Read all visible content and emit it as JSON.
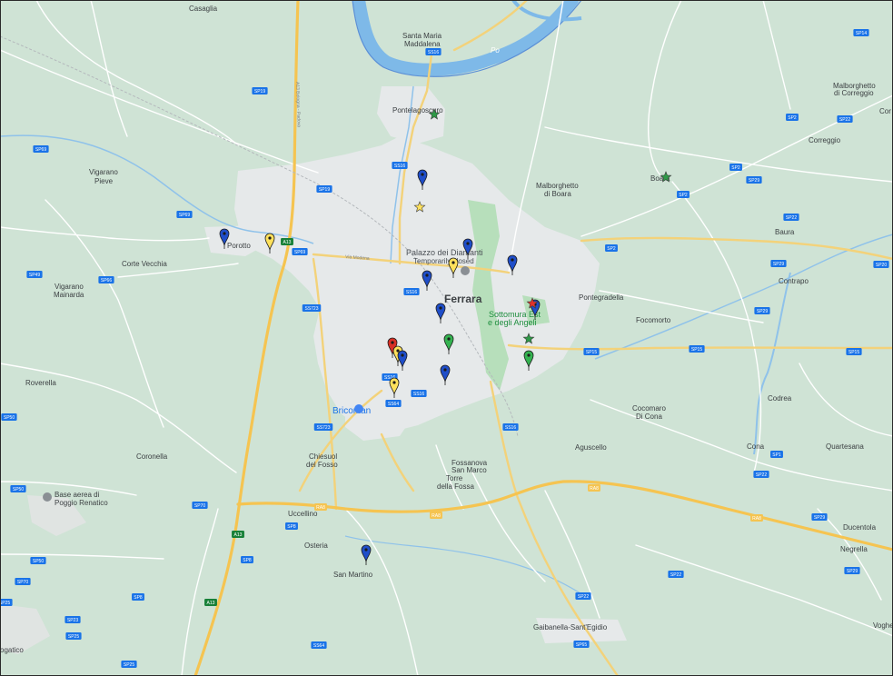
{
  "colors": {
    "land": "#cfe3d5",
    "urban": "#e6e9ea",
    "water": "#7eb9e8",
    "water_edge": "#5b8fd6",
    "motorway": "#f5c451",
    "major_road": "#f3d27a",
    "minor_road": "#ffffff",
    "park": "#b7dfbb",
    "shield": "#1a73e8",
    "pin_blue": "#1f4ec9",
    "pin_yellow": "#ffe15c",
    "pin_red": "#d93025",
    "pin_green": "#34b350",
    "star_green": "#2e9a47",
    "star_yellow": "#ffe15c",
    "star_red": "#e0322b"
  },
  "places": [
    {
      "id": "casaglia",
      "text": "Casaglia",
      "cls": "lbl-town"
    },
    {
      "id": "santa-maria-1",
      "text": "Santa Maria",
      "cls": "lbl-town"
    },
    {
      "id": "santa-maria-2",
      "text": "Maddalena",
      "cls": "lbl-town"
    },
    {
      "id": "pontelagoscuro",
      "text": "Pontelagoscuro",
      "cls": "lbl-town"
    },
    {
      "id": "vigarano-pieve-1",
      "text": "Vigarano",
      "cls": "lbl-town"
    },
    {
      "id": "vigarano-pieve-2",
      "text": "Pieve",
      "cls": "lbl-town"
    },
    {
      "id": "porotto",
      "text": "Porotto",
      "cls": "lbl-town"
    },
    {
      "id": "corte-vecchia",
      "text": "Corte Vecchia",
      "cls": "lbl-town"
    },
    {
      "id": "vigarano-mainarda-1",
      "text": "Vigarano",
      "cls": "lbl-town"
    },
    {
      "id": "vigarano-mainarda-2",
      "text": "Mainarda",
      "cls": "lbl-town"
    },
    {
      "id": "malborghetto-boara-1",
      "text": "Malborghetto",
      "cls": "lbl-town"
    },
    {
      "id": "malborghetto-boara-2",
      "text": "di Boara",
      "cls": "lbl-town"
    },
    {
      "id": "boara",
      "text": "Boara",
      "cls": "lbl-town"
    },
    {
      "id": "malborghetto-correggio-1",
      "text": "Malborghetto",
      "cls": "lbl-town"
    },
    {
      "id": "malborghetto-correggio-2",
      "text": "di Correggio",
      "cls": "lbl-town"
    },
    {
      "id": "correggio",
      "text": "Correggio",
      "cls": "lbl-town"
    },
    {
      "id": "baura",
      "text": "Baura",
      "cls": "lbl-town"
    },
    {
      "id": "contrapo",
      "text": "Contrapo",
      "cls": "lbl-town"
    },
    {
      "id": "pontegradella",
      "text": "Pontegradella",
      "cls": "lbl-town"
    },
    {
      "id": "focomorto",
      "text": "Focomorto",
      "cls": "lbl-town"
    },
    {
      "id": "ferrara",
      "text": "Ferrara",
      "cls": "lbl-city"
    },
    {
      "id": "palazzo-1",
      "text": "Palazzo dei Diamanti",
      "cls": "lbl-poi"
    },
    {
      "id": "palazzo-2",
      "text": "Temporarily closed",
      "cls": "lbl"
    },
    {
      "id": "sottomura-1",
      "text": "Sottomura Est",
      "cls": "lbl-green"
    },
    {
      "id": "sottomura-2",
      "text": "e degli Angeli",
      "cls": "lbl-green"
    },
    {
      "id": "roverella",
      "text": "Roverella",
      "cls": "lbl-town"
    },
    {
      "id": "bricoman",
      "text": "Bricoman",
      "cls": "lbl-blue"
    },
    {
      "id": "chiesuol-1",
      "text": "Chiesuol",
      "cls": "lbl-town"
    },
    {
      "id": "chiesuol-2",
      "text": "del Fosso",
      "cls": "lbl-town"
    },
    {
      "id": "coronella",
      "text": "Coronella",
      "cls": "lbl-town"
    },
    {
      "id": "base-aerea-1",
      "text": "Base aerea di",
      "cls": "lbl-town"
    },
    {
      "id": "base-aerea-2",
      "text": "Poggio Renatico",
      "cls": "lbl-town"
    },
    {
      "id": "fossanova-1",
      "text": "Fossanova",
      "cls": "lbl-town"
    },
    {
      "id": "fossanova-2",
      "text": "San Marco",
      "cls": "lbl-town"
    },
    {
      "id": "torre-1",
      "text": "Torre",
      "cls": "lbl-town"
    },
    {
      "id": "torre-2",
      "text": "della Fossa",
      "cls": "lbl-town"
    },
    {
      "id": "aguscello",
      "text": "Aguscello",
      "cls": "lbl-town"
    },
    {
      "id": "cocomaro-1",
      "text": "Cocomaro",
      "cls": "lbl-town"
    },
    {
      "id": "cocomaro-2",
      "text": "Di Cona",
      "cls": "lbl-town"
    },
    {
      "id": "codrea",
      "text": "Codrea",
      "cls": "lbl-town"
    },
    {
      "id": "cona",
      "text": "Cona",
      "cls": "lbl-town"
    },
    {
      "id": "quartesana",
      "text": "Quartesana",
      "cls": "lbl-town"
    },
    {
      "id": "uccellino",
      "text": "Uccellino",
      "cls": "lbl-town"
    },
    {
      "id": "osteria",
      "text": "Osteria",
      "cls": "lbl-town"
    },
    {
      "id": "san-martino",
      "text": "San Martino",
      "cls": "lbl-town"
    },
    {
      "id": "ducentola",
      "text": "Ducentola",
      "cls": "lbl-town"
    },
    {
      "id": "negrella",
      "text": "Negrella",
      "cls": "lbl-town"
    },
    {
      "id": "gaibanella",
      "text": "Gaibanella-Sant'Egidio",
      "cls": "lbl-town"
    },
    {
      "id": "voghe",
      "text": "Voghe",
      "cls": "lbl-town"
    },
    {
      "id": "cor",
      "text": "Cor",
      "cls": "lbl-town"
    },
    {
      "id": "ogatico",
      "text": "ogatico",
      "cls": "lbl-town"
    },
    {
      "id": "po-river",
      "text": "Po",
      "cls": "lbl-river"
    },
    {
      "id": "a13-name",
      "text": "A13 Bologna - Padova",
      "cls": "lbl-roadname"
    },
    {
      "id": "via-modena",
      "text": "Via Modena",
      "cls": "lbl-roadname"
    },
    {
      "id": "temp-closed",
      "text": "",
      "cls": "lbl"
    }
  ],
  "shields": [
    {
      "id": "ss16-top",
      "text": "SS16"
    },
    {
      "id": "ss16-a",
      "text": "SS16"
    },
    {
      "id": "ss16-b",
      "text": "SS16"
    },
    {
      "id": "ss16-c",
      "text": "SS16"
    },
    {
      "id": "ss16-d",
      "text": "SS16"
    },
    {
      "id": "ss16-e",
      "text": "SS16"
    },
    {
      "id": "sp19-a",
      "text": "SP19"
    },
    {
      "id": "sp19-b",
      "text": "SP19"
    },
    {
      "id": "sp69-a",
      "text": "SP69"
    },
    {
      "id": "sp69-b",
      "text": "SP69"
    },
    {
      "id": "sp69-c",
      "text": "SP69"
    },
    {
      "id": "sp49",
      "text": "SP49"
    },
    {
      "id": "sp66",
      "text": "SP66"
    },
    {
      "id": "sp2-a",
      "text": "SP2"
    },
    {
      "id": "sp2-b",
      "text": "SP2"
    },
    {
      "id": "sp2-c",
      "text": "SP2"
    },
    {
      "id": "sp2-d",
      "text": "SP2"
    },
    {
      "id": "sp22-a",
      "text": "SP22"
    },
    {
      "id": "sp22-b",
      "text": "SP22"
    },
    {
      "id": "sp22-c",
      "text": "SP22"
    },
    {
      "id": "sp22-d",
      "text": "SP22"
    },
    {
      "id": "sp22-e",
      "text": "SP22"
    },
    {
      "id": "sp14",
      "text": "SP14"
    },
    {
      "id": "sp20",
      "text": "SP20"
    },
    {
      "id": "sp29-a",
      "text": "SP29"
    },
    {
      "id": "sp29-b",
      "text": "SP29"
    },
    {
      "id": "sp29-c",
      "text": "SP29"
    },
    {
      "id": "sp29-d",
      "text": "SP29"
    },
    {
      "id": "sp29-e",
      "text": "SP29"
    },
    {
      "id": "sp15-a",
      "text": "SP15"
    },
    {
      "id": "sp15-b",
      "text": "SP15"
    },
    {
      "id": "sp15-c",
      "text": "SP15"
    },
    {
      "id": "ss723-a",
      "text": "SS723"
    },
    {
      "id": "ss723-b",
      "text": "SS723"
    },
    {
      "id": "ss64-a",
      "text": "SS64"
    },
    {
      "id": "ss64-b",
      "text": "SS64"
    },
    {
      "id": "sp25-a",
      "text": "SP25"
    },
    {
      "id": "sp25-b",
      "text": "SP25"
    },
    {
      "id": "sp25-c",
      "text": "SP25"
    },
    {
      "id": "sp50-a",
      "text": "SP50"
    },
    {
      "id": "sp50-b",
      "text": "SP50"
    },
    {
      "id": "sp50-c",
      "text": "SP50"
    },
    {
      "id": "sp70-a",
      "text": "SP70"
    },
    {
      "id": "sp70-b",
      "text": "SP70"
    },
    {
      "id": "sp8-a",
      "text": "SP8"
    },
    {
      "id": "sp8-b",
      "text": "SP8"
    },
    {
      "id": "sp8-c",
      "text": "SP8"
    },
    {
      "id": "sp1",
      "text": "SP1"
    },
    {
      "id": "sp65",
      "text": "SP65"
    },
    {
      "id": "sp23",
      "text": "SP23"
    },
    {
      "id": "ra8-a",
      "text": "RA8"
    },
    {
      "id": "ra8-b",
      "text": "RA8"
    },
    {
      "id": "ra8-c",
      "text": "RA8"
    },
    {
      "id": "ra8-d",
      "text": "RA8"
    },
    {
      "id": "a13-a",
      "text": "A13"
    },
    {
      "id": "a13-b",
      "text": "A13"
    },
    {
      "id": "a13-c",
      "text": "A13"
    }
  ],
  "markers": [
    {
      "id": "pin-1",
      "type": "pin",
      "color": "blue"
    },
    {
      "id": "pin-2",
      "type": "pin",
      "color": "blue"
    },
    {
      "id": "pin-3",
      "type": "pin",
      "color": "yellow"
    },
    {
      "id": "pin-4",
      "type": "pin",
      "color": "blue"
    },
    {
      "id": "pin-5",
      "type": "pin",
      "color": "yellow"
    },
    {
      "id": "pin-6",
      "type": "pin",
      "color": "blue"
    },
    {
      "id": "pin-7",
      "type": "pin",
      "color": "blue"
    },
    {
      "id": "pin-8",
      "type": "pin",
      "color": "blue"
    },
    {
      "id": "pin-9",
      "type": "pin",
      "color": "red"
    },
    {
      "id": "pin-10",
      "type": "pin",
      "color": "yellow"
    },
    {
      "id": "pin-11",
      "type": "pin",
      "color": "blue"
    },
    {
      "id": "pin-12",
      "type": "pin",
      "color": "green"
    },
    {
      "id": "pin-13",
      "type": "pin",
      "color": "blue"
    },
    {
      "id": "pin-14",
      "type": "pin",
      "color": "yellow"
    },
    {
      "id": "pin-15",
      "type": "pin",
      "color": "green"
    },
    {
      "id": "pin-16",
      "type": "pin",
      "color": "blue"
    },
    {
      "id": "pin-17",
      "type": "pin",
      "color": "blue"
    },
    {
      "id": "star-1",
      "type": "star",
      "color": "green"
    },
    {
      "id": "star-2",
      "type": "star",
      "color": "yellow"
    },
    {
      "id": "star-3",
      "type": "star",
      "color": "green"
    },
    {
      "id": "star-4",
      "type": "star",
      "color": "red"
    },
    {
      "id": "star-5",
      "type": "star",
      "color": "green"
    }
  ]
}
